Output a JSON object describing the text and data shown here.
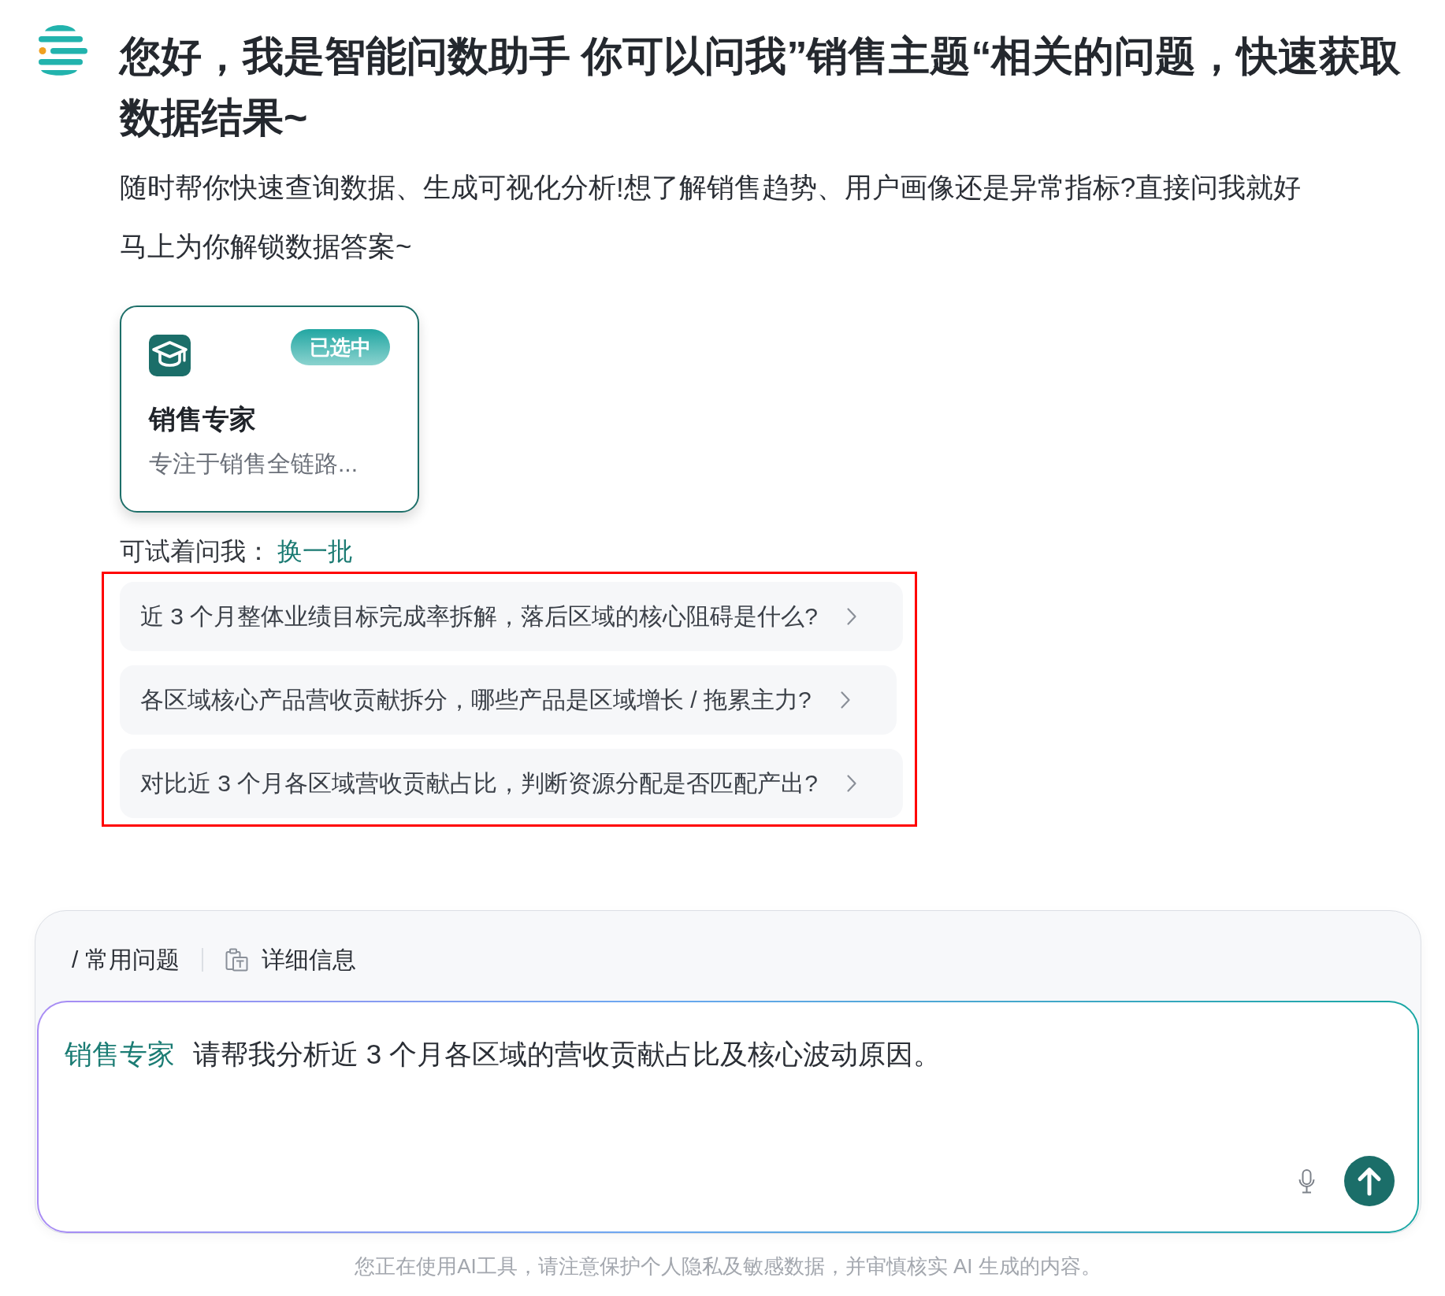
{
  "header": {
    "title": "您好，我是智能问数助手 你可以问我”销售主题“相关的问题，快速获取数据结果~",
    "subtitle": [
      "随时帮你快速查询数据、生成可视化分析!想了解销售趋势、用户画像还是异常指标?直接问我就好",
      "马上为你解锁数据答案~"
    ]
  },
  "experts": [
    {
      "name": "销售专家",
      "description": "专注于销售全链路...",
      "badge": "已选中",
      "selected": true
    }
  ],
  "suggestions": {
    "label": "可试着问我：",
    "refresh": "换一批",
    "highlighted": true,
    "items": [
      "近 3 个月整体业绩目标完成率拆解，落后区域的核心阻碍是什么?",
      "各区域核心产品营收贡献拆分，哪些产品是区域增长 / 拖累主力?",
      "对比近 3 个月各区域营收贡献占比，判断资源分配是否匹配产出?"
    ]
  },
  "composer": {
    "tools": [
      {
        "kind": "text",
        "label": "/ 常用问题"
      },
      {
        "kind": "icon",
        "label": "详细信息"
      }
    ],
    "tag": "销售专家",
    "value": "请帮我分析近 3 个月各区域的营收贡献占比及核心波动原因。"
  },
  "footer": "您正在使用AI工具，请注意保护个人隐私及敏感数据，并审慎核实 AI 生成的内容。"
}
